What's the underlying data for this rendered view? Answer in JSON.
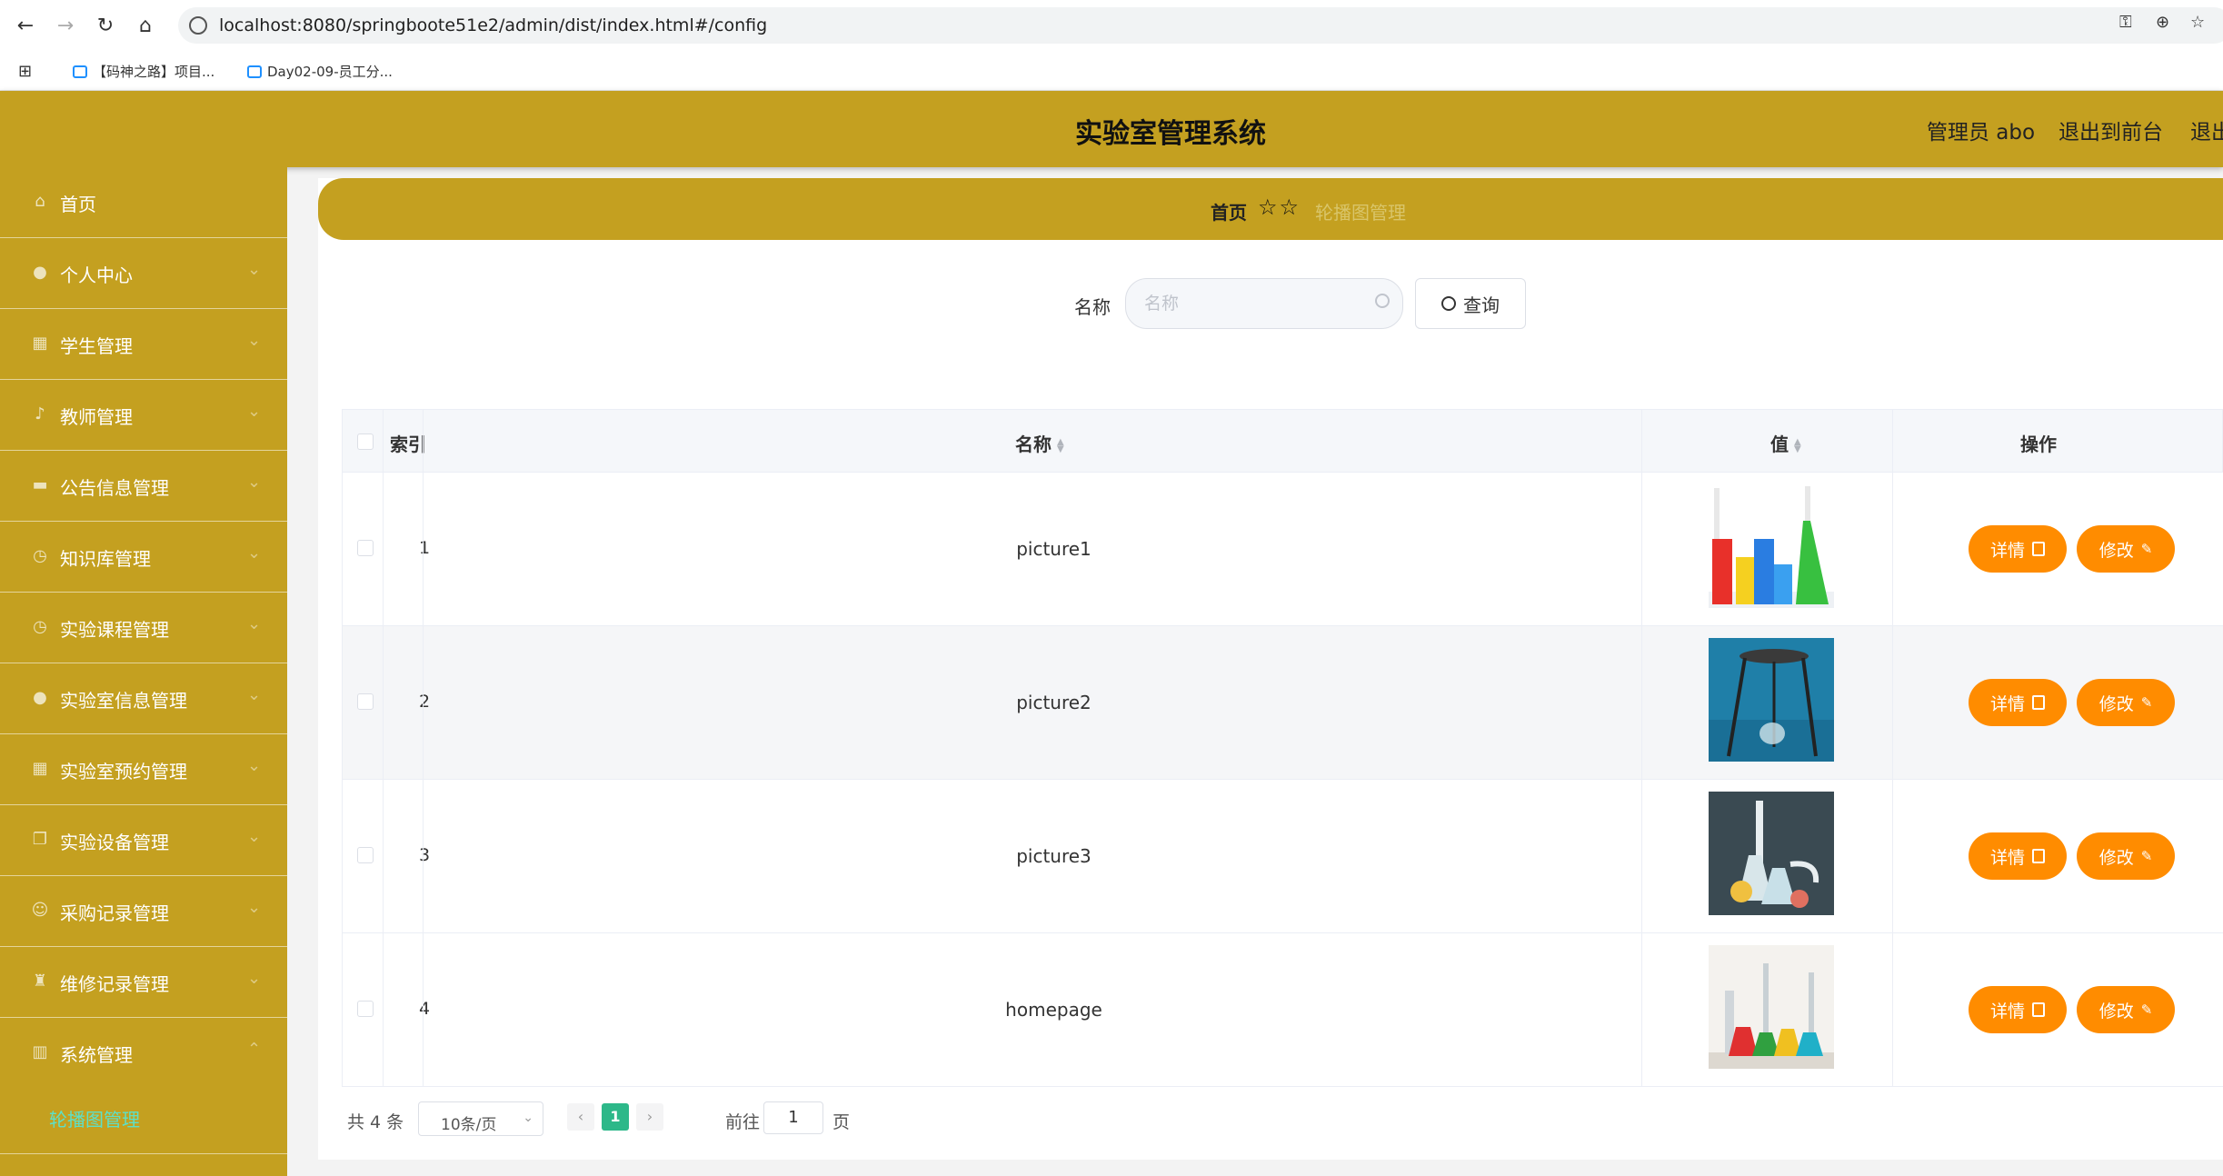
{
  "browser": {
    "url": "localhost:8080/springboote51e2/admin/dist/index.html#/config",
    "bookmarks": [
      "【码神之路】项目...",
      "Day02-09-员工分..."
    ]
  },
  "header": {
    "title": "实验室管理系统",
    "user": "管理员 abo",
    "to_frontend": "退出到前台",
    "logout": "退出"
  },
  "sidebar": {
    "items": [
      {
        "label": "首页",
        "icon": "home-icon"
      },
      {
        "label": "个人中心",
        "icon": "user-icon"
      },
      {
        "label": "学生管理",
        "icon": "book-icon"
      },
      {
        "label": "教师管理",
        "icon": "microphone-icon"
      },
      {
        "label": "公告信息管理",
        "icon": "briefcase-icon"
      },
      {
        "label": "知识库管理",
        "icon": "clock-icon"
      },
      {
        "label": "实验课程管理",
        "icon": "clock-icon"
      },
      {
        "label": "实验室信息管理",
        "icon": "user-icon"
      },
      {
        "label": "实验室预约管理",
        "icon": "book-icon"
      },
      {
        "label": "实验设备管理",
        "icon": "copy-icon"
      },
      {
        "label": "采购记录管理",
        "icon": "smile-icon"
      },
      {
        "label": "维修记录管理",
        "icon": "trophy-icon"
      },
      {
        "label": "系统管理",
        "icon": "chart-icon"
      }
    ],
    "submenu": {
      "label": "轮播图管理"
    }
  },
  "breadcrumb": {
    "home": "首页",
    "current": "轮播图管理"
  },
  "search": {
    "label": "名称",
    "placeholder": "名称",
    "button": "查询"
  },
  "table": {
    "headers": {
      "index": "索引",
      "name": "名称",
      "value": "值",
      "actions": "操作"
    },
    "rows": [
      {
        "index": "1",
        "name": "picture1"
      },
      {
        "index": "2",
        "name": "picture2"
      },
      {
        "index": "3",
        "name": "picture3"
      },
      {
        "index": "4",
        "name": "homepage"
      }
    ],
    "detail_label": "详情",
    "edit_label": "修改"
  },
  "pagination": {
    "total": "共 4 条",
    "page_size": "10条/页",
    "current_page": "1",
    "goto_label": "前往",
    "goto_value": "1",
    "page_suffix": "页"
  },
  "colors": {
    "theme": "#c4a020",
    "action_button": "#ff8c00",
    "active_page": "#2db889",
    "active_submenu": "#5de0c8"
  }
}
